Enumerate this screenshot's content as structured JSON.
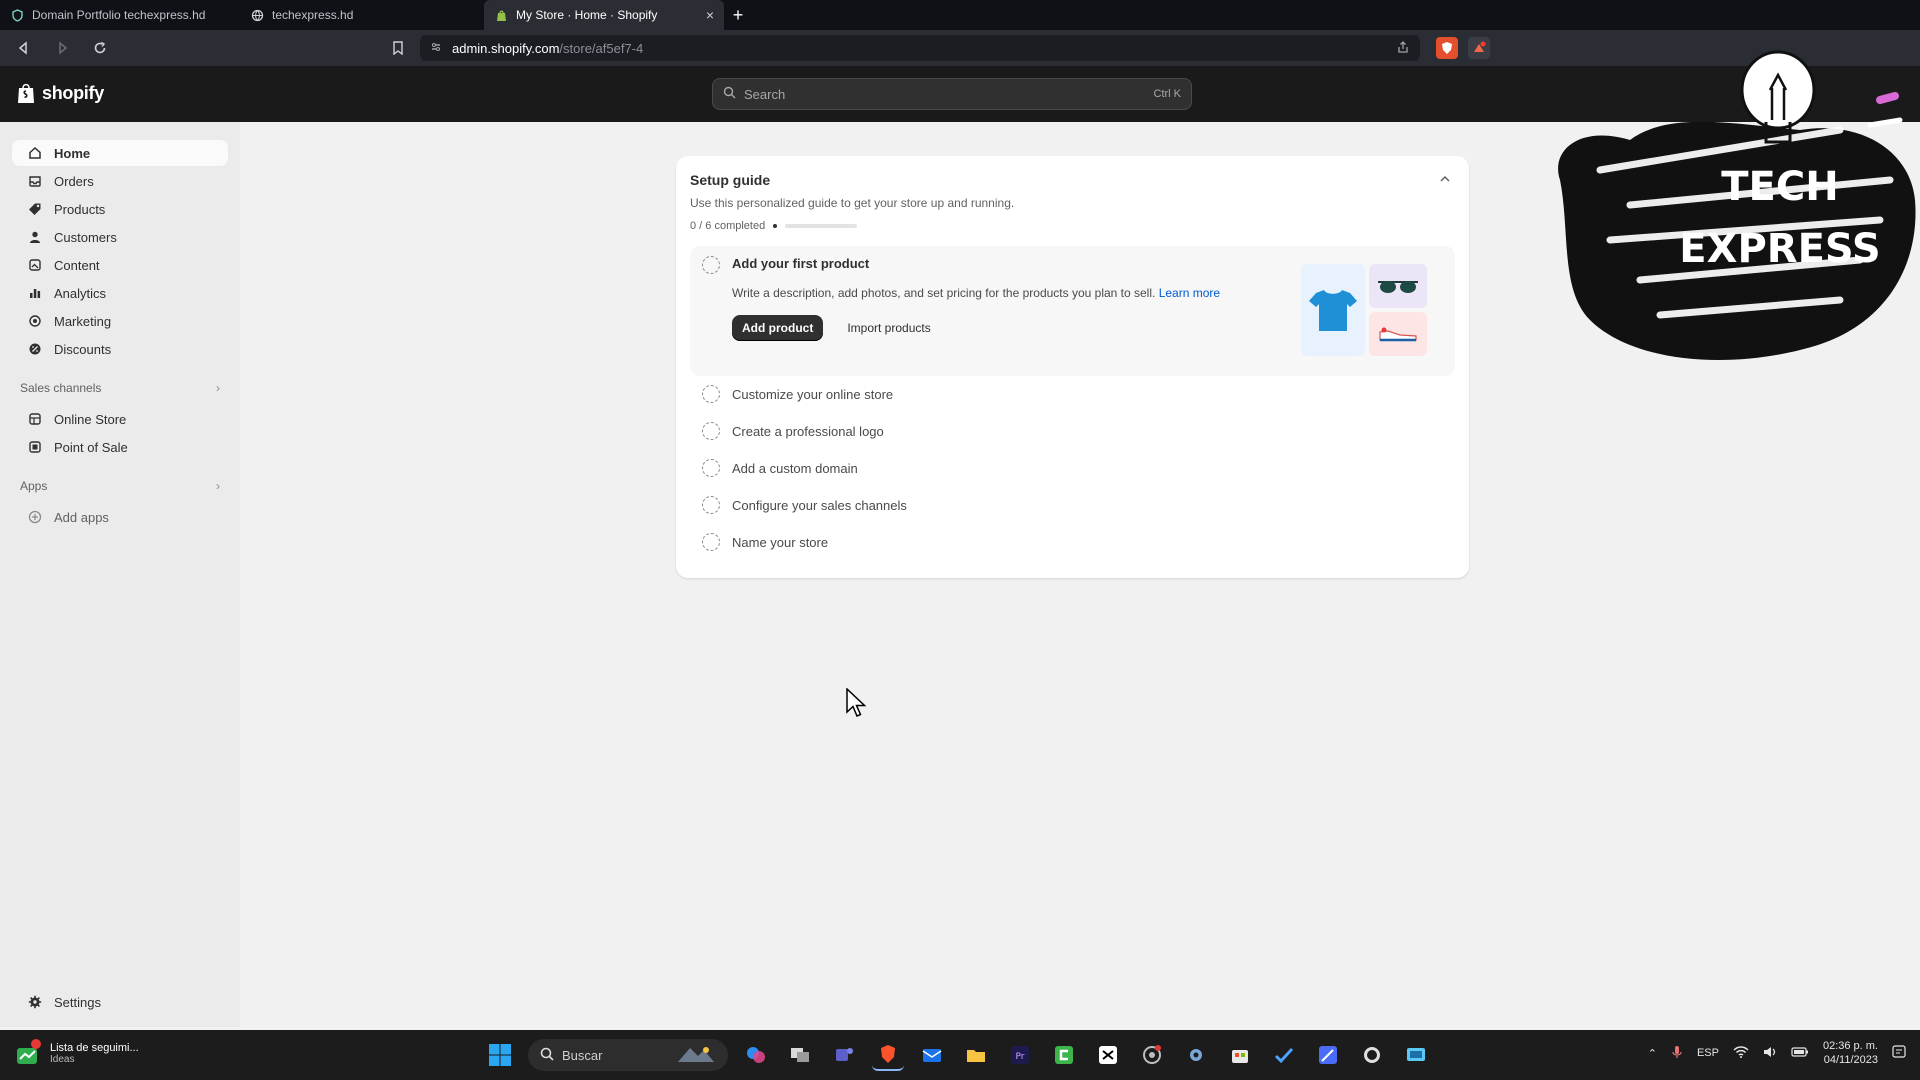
{
  "browser": {
    "tabs": [
      {
        "label": "Domain Portfolio techexpress.hd",
        "active": false
      },
      {
        "label": "techexpress.hd",
        "active": false
      },
      {
        "label": "My Store · Home · Shopify",
        "active": true
      }
    ],
    "new_tab": "+",
    "close_glyph": "×",
    "url_host": "admin.shopify.com",
    "url_path": "/store/af5ef7-4"
  },
  "shopify": {
    "logo_text": "shopify",
    "search_placeholder": "Search",
    "search_shortcut": "Ctrl K"
  },
  "sidebar": {
    "items": [
      {
        "label": "Home",
        "icon": "home-icon",
        "active": true
      },
      {
        "label": "Orders",
        "icon": "orders-icon"
      },
      {
        "label": "Products",
        "icon": "tag-icon"
      },
      {
        "label": "Customers",
        "icon": "person-icon"
      },
      {
        "label": "Content",
        "icon": "content-icon"
      },
      {
        "label": "Analytics",
        "icon": "chart-icon"
      },
      {
        "label": "Marketing",
        "icon": "target-icon"
      },
      {
        "label": "Discounts",
        "icon": "discount-icon"
      }
    ],
    "sales_channels_label": "Sales channels",
    "sales_channels": [
      {
        "label": "Online Store",
        "icon": "store-icon"
      },
      {
        "label": "Point of Sale",
        "icon": "pos-icon"
      }
    ],
    "apps_label": "Apps",
    "apps": [
      {
        "label": "Add apps",
        "icon": "plus-circle-icon"
      }
    ],
    "settings_label": "Settings"
  },
  "setup_guide": {
    "title": "Setup guide",
    "subtitle": "Use this personalized guide to get your store up and running.",
    "progress_text": "0 / 6 completed",
    "progress": 0,
    "expanded_task": {
      "title": "Add your first product",
      "description": "Write a description, add photos, and set pricing for the products you plan to sell.",
      "learn_more": "Learn more",
      "primary_action": "Add product",
      "secondary_action": "Import products"
    },
    "tasks": [
      "Customize your online store",
      "Create a professional logo",
      "Add a custom domain",
      "Configure your sales channels",
      "Name your store"
    ]
  },
  "overlay": {
    "line1": "TECH",
    "line2": "EXPRESS"
  },
  "taskbar": {
    "widget_line1": "Lista de seguimi...",
    "widget_line2": "Ideas",
    "search_placeholder": "Buscar",
    "language": "ESP",
    "time": "02:36 p. m.",
    "date": "04/11/2023"
  },
  "colors": {
    "accent_link": "#005bd3",
    "shopify_bar": "#1a1a1a",
    "primary_button": "#303030"
  }
}
